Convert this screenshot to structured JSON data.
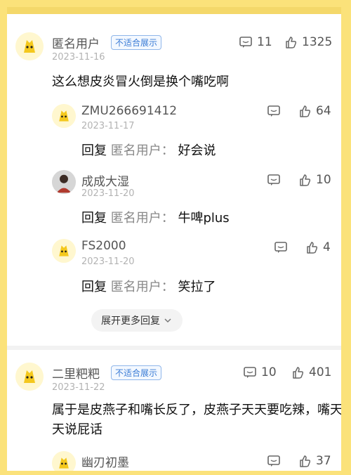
{
  "comments": [
    {
      "author": "匿名用户",
      "badge": "不适合展示",
      "date": "2023-11-16",
      "text": "这么想皮炎冒火倒是换个嘴吃啊",
      "reply_count": "11",
      "like_count": "1325"
    },
    {
      "author": "二里粑粑",
      "badge": "不适合展示",
      "date": "2023-11-22",
      "text": "属于是皮燕子和嘴长反了，皮燕子天天要吃辣，嘴天天说屁话",
      "reply_count": "10",
      "like_count": "401"
    }
  ],
  "replies": [
    {
      "author": "ZMU266691412",
      "date": "2023-11-17",
      "prefix": "回复",
      "target": "匿名用户：",
      "text": "好会说",
      "like_count": "64"
    },
    {
      "author": "成成大湿",
      "date": "2023-11-20",
      "prefix": "回复",
      "target": "匿名用户：",
      "text": "牛啤plus",
      "like_count": "10"
    },
    {
      "author": "FS2000",
      "date": "2023-11-20",
      "prefix": "回复",
      "target": "匿名用户：",
      "text": "笑拉了",
      "like_count": "4"
    },
    {
      "author": "幽刃初墨",
      "like_count": "37"
    }
  ],
  "more_replies_label": "展开更多回复",
  "icons": {
    "comment": "comment-icon",
    "like": "thumbs-up-icon",
    "chevron": "chevron-down-icon"
  },
  "colors": {
    "background": "#fbe27a",
    "badge": "#3a7bd5"
  }
}
